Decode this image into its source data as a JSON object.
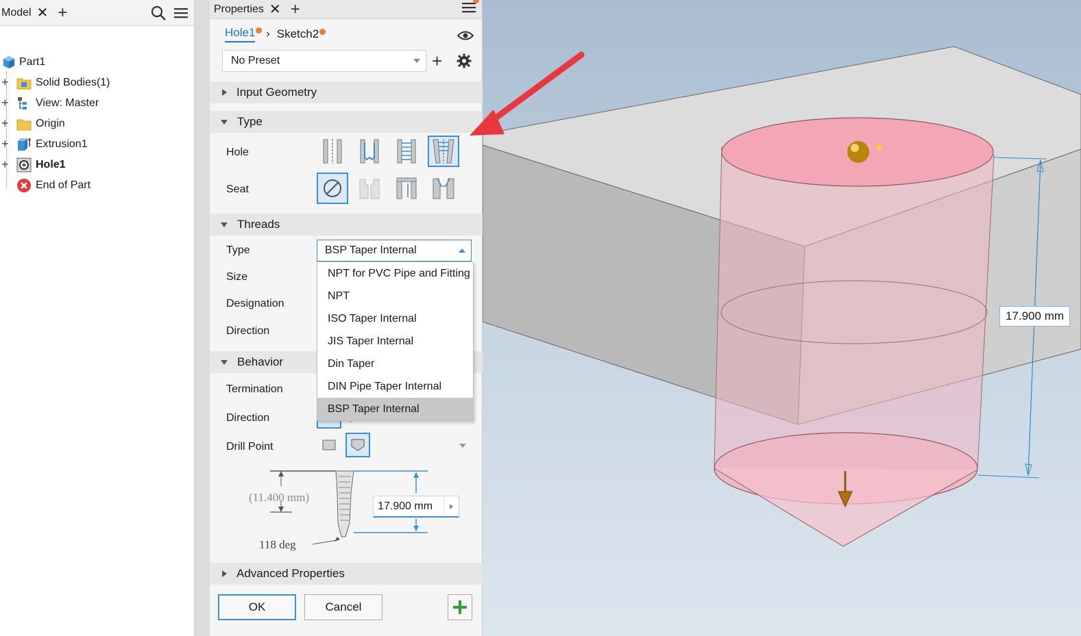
{
  "model_browser": {
    "tab_label": "Model",
    "items": [
      {
        "label": "Part1",
        "icon": "part-icon",
        "expandable": false,
        "bold": false
      },
      {
        "label": "Solid Bodies(1)",
        "icon": "solid-bodies-folder-icon",
        "expandable": true,
        "bold": false
      },
      {
        "label": "View: Master",
        "icon": "view-icon",
        "expandable": true,
        "bold": false
      },
      {
        "label": "Origin",
        "icon": "folder-icon",
        "expandable": true,
        "bold": false
      },
      {
        "label": "Extrusion1",
        "icon": "extrusion-icon",
        "expandable": true,
        "bold": false
      },
      {
        "label": "Hole1",
        "icon": "hole-feature-icon",
        "expandable": true,
        "bold": true
      },
      {
        "label": "End of Part",
        "icon": "end-of-part-icon",
        "expandable": false,
        "bold": false
      }
    ]
  },
  "properties": {
    "tab_label": "Properties",
    "breadcrumb": [
      "Hole1",
      "Sketch2"
    ],
    "preset": "No Preset",
    "sections": {
      "input_geometry": "Input Geometry",
      "type": "Type",
      "threads": "Threads",
      "behavior": "Behavior",
      "advanced": "Advanced Properties"
    },
    "type_rows": {
      "hole": "Hole",
      "seat": "Seat"
    },
    "thread_rows": {
      "type": "Type",
      "size": "Size",
      "designation": "Designation",
      "direction": "Direction"
    },
    "thread_type_value": "BSP Taper Internal",
    "thread_type_options": [
      "NPT for PVC Pipe and Fitting",
      "NPT",
      "ISO Taper Internal",
      "JIS Taper Internal",
      "Din Taper",
      "DIN Pipe Taper Internal",
      "BSP Taper Internal"
    ],
    "selected_option_index": 6,
    "behavior_rows": {
      "termination": "Termination",
      "direction": "Direction",
      "drill_point": "Drill Point"
    },
    "diagram": {
      "thread_depth": "(11.400 mm)",
      "drill_angle": "118 deg",
      "depth_value": "17.900 mm"
    },
    "buttons": {
      "ok": "OK",
      "cancel": "Cancel"
    }
  },
  "viewport": {
    "dimension_label": "17.900 mm"
  },
  "colors": {
    "accent": "#3b8fd0",
    "notify": "#f07d2a",
    "annotation_arrow": "#e8383d",
    "hole_fill": "#f2a6b6",
    "apply_plus": "#2e9e3a"
  }
}
